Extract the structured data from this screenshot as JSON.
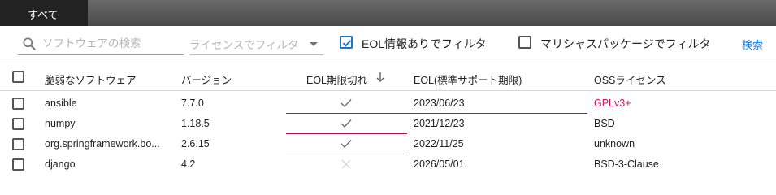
{
  "tabs": [
    {
      "label": "すべて",
      "active": true
    }
  ],
  "filters": {
    "search_placeholder": "ソフトウェアの検索",
    "license_placeholder": "ライセンスでフィルタ",
    "eol_filter_label": "EOL情報ありでフィルタ",
    "eol_filter_checked": true,
    "malicious_filter_label": "マリシャスパッケージでフィルタ",
    "malicious_filter_checked": false,
    "search_button": "検索"
  },
  "table": {
    "columns": {
      "software": "脆弱なソフトウェア",
      "version": "バージョン",
      "eol_expired": "EOL期限切れ",
      "eol_date": "EOL(標準サポート期限)",
      "license": "OSSライセンス"
    },
    "sort": {
      "column": "eol_expired",
      "direction": "desc"
    },
    "rows": [
      {
        "name": "ansible",
        "version": "7.7.0",
        "eol_expired": true,
        "eol_date": "2023/06/23",
        "license": "GPLv3+",
        "license_highlight": true,
        "underline": "both"
      },
      {
        "name": "numpy",
        "version": "1.18.5",
        "eol_expired": true,
        "eol_date": "2021/12/23",
        "license": "BSD",
        "license_highlight": false,
        "underline": "left"
      },
      {
        "name": "org.springframework.bo...",
        "version": "2.6.15",
        "eol_expired": true,
        "eol_date": "2022/11/25",
        "license": "unknown",
        "license_highlight": false,
        "underline": "left"
      },
      {
        "name": "django",
        "version": "4.2",
        "eol_expired": false,
        "eol_date": "2026/05/01",
        "license": "BSD-3-Clause",
        "license_highlight": false,
        "underline": "none"
      }
    ]
  },
  "colors": {
    "accent": "#1976d2",
    "alert": "#c2185b",
    "tab_active": "#222222"
  }
}
